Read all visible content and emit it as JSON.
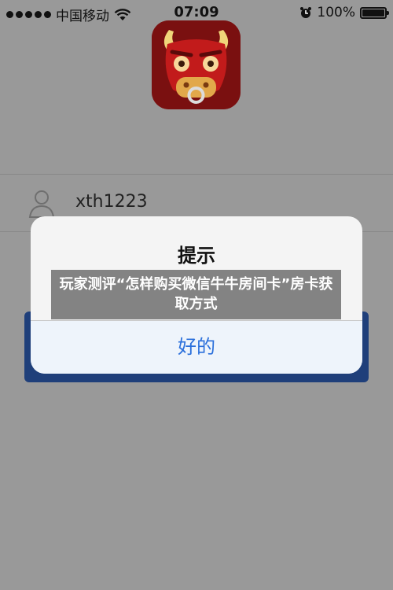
{
  "status_bar": {
    "carrier": "中国移动",
    "time": "07:09",
    "battery": "100%",
    "signal_icon": "signal-dots-icon",
    "wifi_icon": "wifi-icon",
    "alarm_icon": "alarm-icon",
    "battery_icon": "battery-icon"
  },
  "app": {
    "logo_icon": "bull-face-logo-icon"
  },
  "login": {
    "username": "xth1223",
    "user_icon": "user-icon"
  },
  "dialog": {
    "title": "提示",
    "ok_label": "好的"
  },
  "banner": {
    "text": "玩家测评“怎样购买微信牛牛房间卡”房卡获取方式"
  },
  "colors": {
    "background": "#999999",
    "logo_red": "#c21b1b",
    "dialog_button_blue": "#2a6fdb",
    "login_button_blue": "#1f3f7a"
  }
}
